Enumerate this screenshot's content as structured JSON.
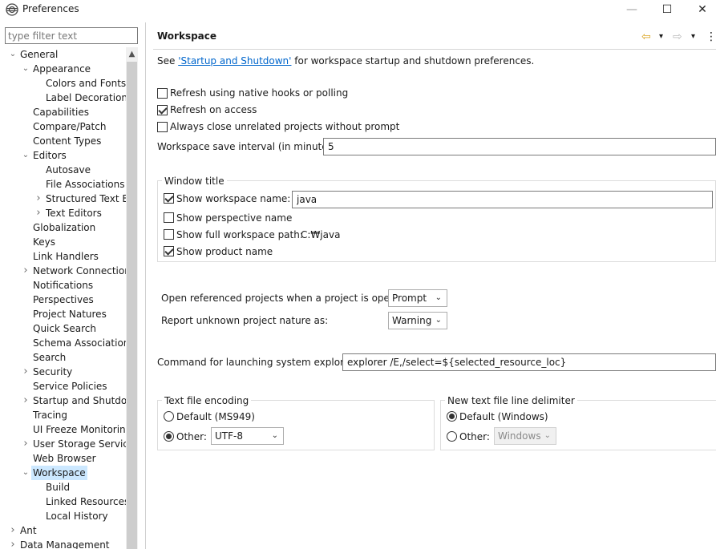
{
  "window": {
    "title": "Preferences",
    "minimize_symbol": "—",
    "maximize_symbol": "☐",
    "close_symbol": "✕"
  },
  "filter": {
    "placeholder": "type filter text",
    "value": ""
  },
  "tree": {
    "selected": "Workspace",
    "items": [
      {
        "label": "General",
        "level": 0,
        "state": "expanded"
      },
      {
        "label": "Appearance",
        "level": 1,
        "state": "expanded"
      },
      {
        "label": "Colors and Fonts",
        "level": 2,
        "state": "leaf"
      },
      {
        "label": "Label Decorations",
        "level": 2,
        "state": "leaf"
      },
      {
        "label": "Capabilities",
        "level": 1,
        "state": "leaf"
      },
      {
        "label": "Compare/Patch",
        "level": 1,
        "state": "leaf"
      },
      {
        "label": "Content Types",
        "level": 1,
        "state": "leaf"
      },
      {
        "label": "Editors",
        "level": 1,
        "state": "expanded"
      },
      {
        "label": "Autosave",
        "level": 2,
        "state": "leaf"
      },
      {
        "label": "File Associations",
        "level": 2,
        "state": "leaf"
      },
      {
        "label": "Structured Text Ed",
        "level": 2,
        "state": "collapsed"
      },
      {
        "label": "Text Editors",
        "level": 2,
        "state": "collapsed"
      },
      {
        "label": "Globalization",
        "level": 1,
        "state": "leaf"
      },
      {
        "label": "Keys",
        "level": 1,
        "state": "leaf"
      },
      {
        "label": "Link Handlers",
        "level": 1,
        "state": "leaf"
      },
      {
        "label": "Network Connection",
        "level": 1,
        "state": "collapsed"
      },
      {
        "label": "Notifications",
        "level": 1,
        "state": "leaf"
      },
      {
        "label": "Perspectives",
        "level": 1,
        "state": "leaf"
      },
      {
        "label": "Project Natures",
        "level": 1,
        "state": "leaf"
      },
      {
        "label": "Quick Search",
        "level": 1,
        "state": "leaf"
      },
      {
        "label": "Schema Associations",
        "level": 1,
        "state": "leaf"
      },
      {
        "label": "Search",
        "level": 1,
        "state": "leaf"
      },
      {
        "label": "Security",
        "level": 1,
        "state": "collapsed"
      },
      {
        "label": "Service Policies",
        "level": 1,
        "state": "leaf"
      },
      {
        "label": "Startup and Shutdow",
        "level": 1,
        "state": "collapsed"
      },
      {
        "label": "Tracing",
        "level": 1,
        "state": "leaf"
      },
      {
        "label": "UI Freeze Monitoring",
        "level": 1,
        "state": "leaf"
      },
      {
        "label": "User Storage Service",
        "level": 1,
        "state": "collapsed"
      },
      {
        "label": "Web Browser",
        "level": 1,
        "state": "leaf"
      },
      {
        "label": "Workspace",
        "level": 1,
        "state": "expanded"
      },
      {
        "label": "Build",
        "level": 2,
        "state": "leaf"
      },
      {
        "label": "Linked Resources",
        "level": 2,
        "state": "leaf"
      },
      {
        "label": "Local History",
        "level": 2,
        "state": "leaf"
      },
      {
        "label": "Ant",
        "level": 0,
        "state": "collapsed"
      },
      {
        "label": "Data Management",
        "level": 0,
        "state": "collapsed"
      }
    ]
  },
  "page": {
    "title": "Workspace",
    "intro_prefix": "See ",
    "intro_link": "'Startup and Shutdown'",
    "intro_suffix": " for workspace startup and shutdown preferences.",
    "options": {
      "refresh_native": {
        "label": "Refresh using native hooks or polling",
        "checked": false
      },
      "refresh_access": {
        "label": "Refresh on access",
        "checked": true
      },
      "always_close": {
        "label": "Always close unrelated projects without prompt",
        "checked": false
      }
    },
    "save_interval": {
      "label": "Workspace save interval (in minutes):",
      "value": "5"
    },
    "window_title": {
      "group_label": "Window title",
      "show_workspace_name": {
        "label": "Show workspace name:",
        "checked": true,
        "value": "java"
      },
      "show_perspective_name": {
        "label": "Show perspective name",
        "checked": false
      },
      "show_full_path": {
        "label": "Show full workspace path:",
        "checked": false,
        "value": "C:₩java"
      },
      "show_product_name": {
        "label": "Show product name",
        "checked": true
      }
    },
    "open_referenced": {
      "label": "Open referenced projects when a project is opened:",
      "value": "Prompt"
    },
    "report_unknown": {
      "label": "Report unknown project nature as:",
      "value": "Warning"
    },
    "system_explorer": {
      "label": "Command for launching system explorer:",
      "value": "explorer /E,/select=${selected_resource_loc}"
    },
    "text_encoding": {
      "group_label": "Text file encoding",
      "default_label": "Default (MS949)",
      "other_label": "Other:",
      "selected": "other",
      "other_value": "UTF-8"
    },
    "line_delimiter": {
      "group_label": "New text file line delimiter",
      "default_label": "Default (Windows)",
      "other_label": "Other:",
      "selected": "default",
      "other_value": "Windows"
    }
  },
  "icons": {
    "back": "⇦",
    "forward": "⇨",
    "dropdown": "▾",
    "menu": "⋮",
    "expanded": "⌄",
    "collapsed": "›",
    "scroll_up": "▲"
  },
  "colors": {
    "selection": "#cce8ff",
    "link": "#0066cc",
    "back_arrow": "#d9a21b",
    "forward_arrow": "#b9b9b9"
  }
}
